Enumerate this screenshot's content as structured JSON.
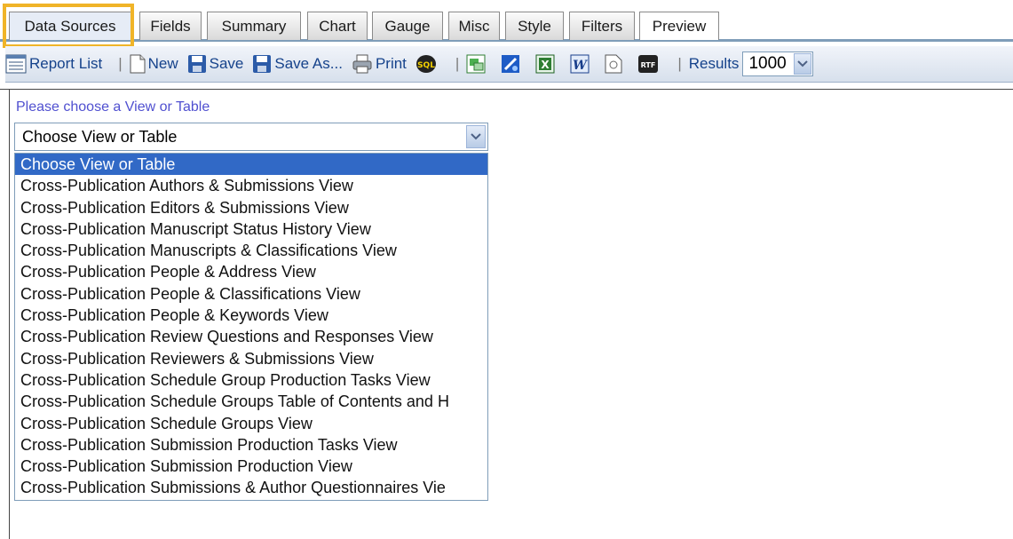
{
  "tabs": {
    "data_sources": "Data Sources",
    "fields": "Fields",
    "summary": "Summary",
    "chart": "Chart",
    "gauge": "Gauge",
    "misc": "Misc",
    "style": "Style",
    "filters": "Filters",
    "preview": "Preview"
  },
  "toolbar": {
    "report_list": "Report List",
    "new": "New",
    "save": "Save",
    "save_as": "Save As...",
    "print": "Print",
    "results_label": "Results",
    "results_value": "1000",
    "icons": [
      "report-list-icon",
      "new-document-icon",
      "save-icon",
      "save-as-icon",
      "print-icon",
      "sql-icon",
      "export-csv-icon",
      "export-xml-icon",
      "export-excel-icon",
      "export-word-icon",
      "export-pdf-icon",
      "export-rtf-icon"
    ]
  },
  "content": {
    "prompt": "Please choose a View or Table",
    "select_value": "Choose View or Table",
    "options": [
      "Choose View or Table",
      "Cross-Publication Authors & Submissions View",
      "Cross-Publication Editors & Submissions View",
      "Cross-Publication Manuscript Status History View",
      "Cross-Publication Manuscripts & Classifications View",
      "Cross-Publication People & Address View",
      "Cross-Publication People & Classifications View",
      "Cross-Publication People & Keywords View",
      "Cross-Publication Review Questions and Responses View",
      "Cross-Publication Reviewers & Submissions View",
      "Cross-Publication Schedule Group Production Tasks View",
      "Cross-Publication Schedule Groups Table of Contents and H",
      "Cross-Publication Schedule Groups View",
      "Cross-Publication Submission Production Tasks View",
      "Cross-Publication Submission Production View",
      "Cross-Publication Submissions & Author Questionnaires Vie"
    ]
  },
  "colors": {
    "highlight": "#f0b428",
    "selected_option": "#3169c6",
    "link_text": "#15428b"
  }
}
